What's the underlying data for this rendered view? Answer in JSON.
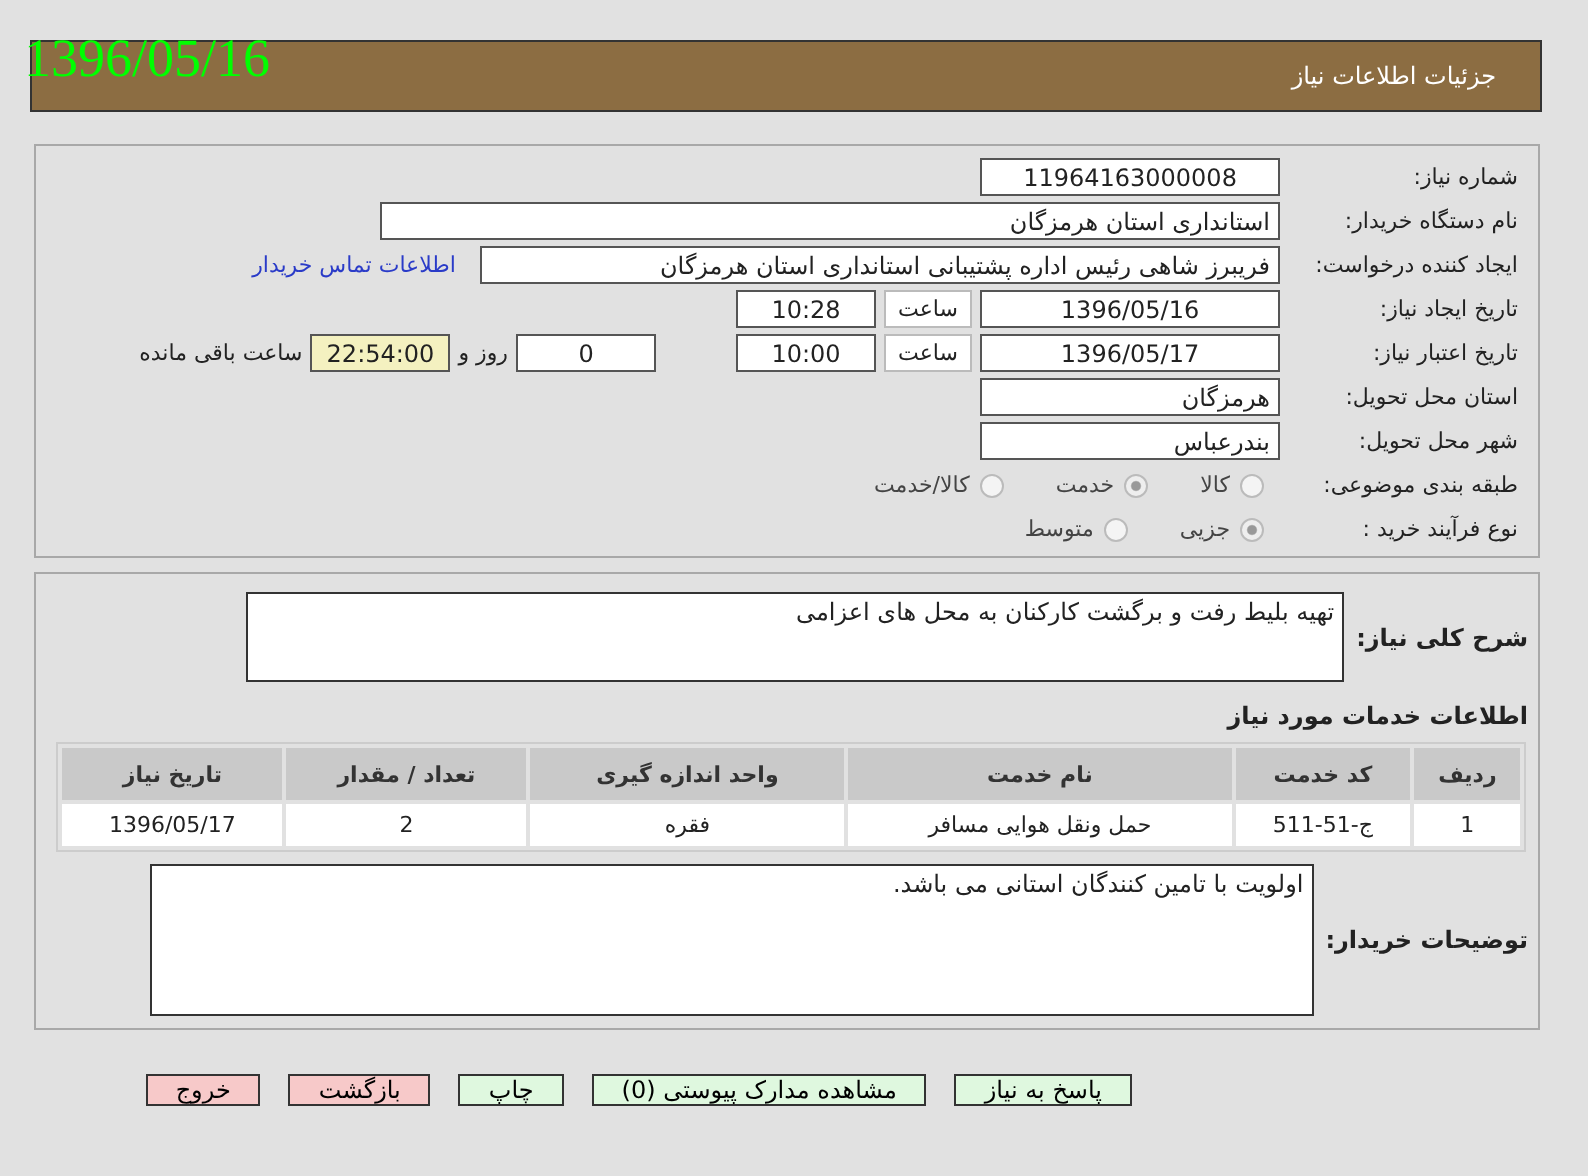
{
  "date_stamp": "1396/05/16",
  "header": {
    "title": "جزئیات اطلاعات نیاز"
  },
  "fields": [
    {
      "kind": "short",
      "label": "شماره نیاز:",
      "value": "11964163000008"
    },
    {
      "kind": "long",
      "label": "نام دستگاه خریدار:",
      "value": "استانداری استان هرمزگان"
    },
    {
      "kind": "requester",
      "label": "ایجاد کننده درخواست:",
      "value": "فریبرز  شاهی  رئیس اداره پشتیبانی  استانداری استان هرمزگان",
      "link": "اطلاعات تماس خریدار"
    },
    {
      "kind": "created",
      "label": "تاریخ ایجاد نیاز:",
      "value": "1396/05/16",
      "time_label": "ساعت",
      "time": "10:28"
    },
    {
      "kind": "deadline",
      "label": "تاریخ اعتبار نیاز:",
      "value": "1396/05/17",
      "time_label": "ساعت",
      "time": "10:00",
      "days": "0",
      "days_label": "روز و",
      "remaining": "22:54:00",
      "remaining_label": "ساعت باقی مانده"
    },
    {
      "kind": "short",
      "label": "استان محل تحویل:",
      "value": "هرمزگان"
    },
    {
      "kind": "short",
      "label": "شهر محل تحویل:",
      "value": "بندرعباس"
    },
    {
      "kind": "radio",
      "label": "طبقه بندی موضوعی:",
      "options": [
        {
          "label": "کالا",
          "selected": false
        },
        {
          "label": "خدمت",
          "selected": true
        },
        {
          "label": "کالا/خدمت",
          "selected": false
        }
      ]
    },
    {
      "kind": "radio",
      "label": "نوع فرآیند خرید :",
      "options": [
        {
          "label": "جزیی",
          "selected": true
        },
        {
          "label": "متوسط",
          "selected": false
        }
      ]
    }
  ],
  "description": {
    "label": "شرح کلی نیاز:",
    "value": "تهیه بلیط رفت و برگشت کارکنان به محل های اعزامی"
  },
  "services": {
    "title": "اطلاعات خدمات مورد نیاز",
    "columns": [
      "ردیف",
      "کد خدمت",
      "نام خدمت",
      "واحد اندازه گیری",
      "تعداد / مقدار",
      "تاریخ نیاز"
    ],
    "rows": [
      [
        "1",
        "ج-51-511",
        "حمل ونقل هوایی مسافر",
        "فقره",
        "2",
        "1396/05/17"
      ]
    ]
  },
  "buyer_notes": {
    "label": "توضیحات خریدار:",
    "value": "اولویت با تامین کنندگان استانی می باشد."
  },
  "buttons": [
    {
      "label": "پاسخ به نیاز",
      "kind": "action"
    },
    {
      "label": "مشاهده مدارک پیوستی (0)",
      "kind": "action"
    },
    {
      "label": "چاپ",
      "kind": "action"
    },
    {
      "label": "بازگشت",
      "kind": "exit"
    },
    {
      "label": "خروج",
      "kind": "exit"
    }
  ]
}
